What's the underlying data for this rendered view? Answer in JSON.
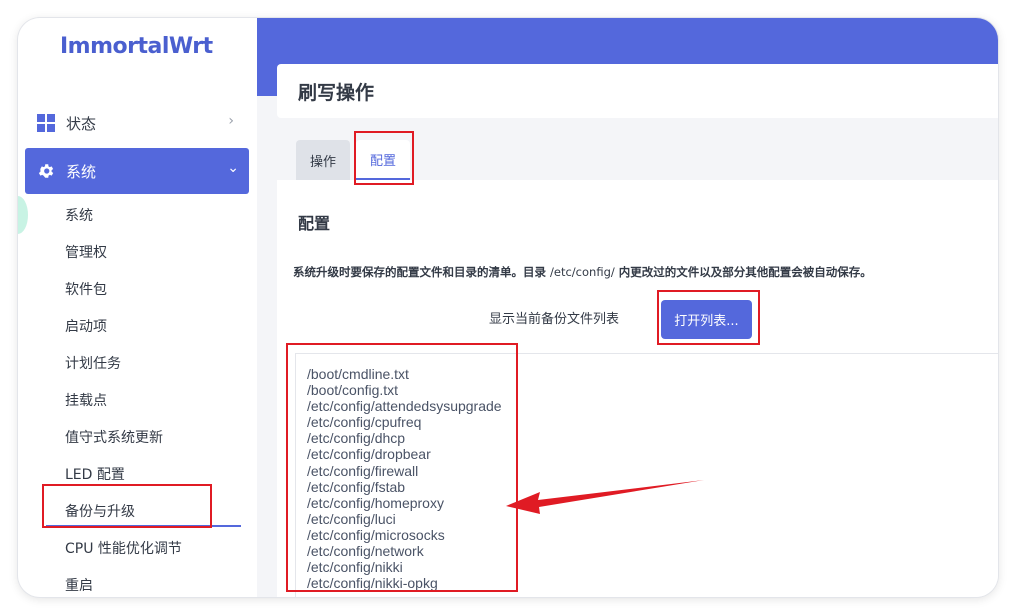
{
  "app": {
    "logo": "ImmortalWrt"
  },
  "sidebar": {
    "status_label": "状态",
    "system_label": "系统",
    "sub_items": [
      "系统",
      "管理权",
      "软件包",
      "启动项",
      "计划任务",
      "挂载点",
      "值守式系统更新",
      "LED 配置",
      "备份与升级",
      "CPU 性能优化调节",
      "重启"
    ]
  },
  "page": {
    "title": "刷写操作",
    "tabs": [
      "操作",
      "配置"
    ],
    "section_title": "配置",
    "desc_part1": "系统升级时要保存的配置文件和目录的清单。目录 ",
    "desc_path": "/etc/config/",
    "desc_part2": " 内更改过的文件以及部分其他配置会被自动保存。",
    "show_label": "显示当前备份文件列表",
    "open_button": "打开列表...",
    "files": [
      "/boot/cmdline.txt",
      "/boot/config.txt",
      "/etc/config/attendedsysupgrade",
      "/etc/config/cpufreq",
      "/etc/config/dhcp",
      "/etc/config/dropbear",
      "/etc/config/firewall",
      "/etc/config/fstab",
      "/etc/config/homeproxy",
      "/etc/config/luci",
      "/etc/config/microsocks",
      "/etc/config/network",
      "/etc/config/nikki",
      "/etc/config/nikki-opkg"
    ]
  },
  "colors": {
    "accent": "#5468dc",
    "annotation": "#e01b24"
  }
}
